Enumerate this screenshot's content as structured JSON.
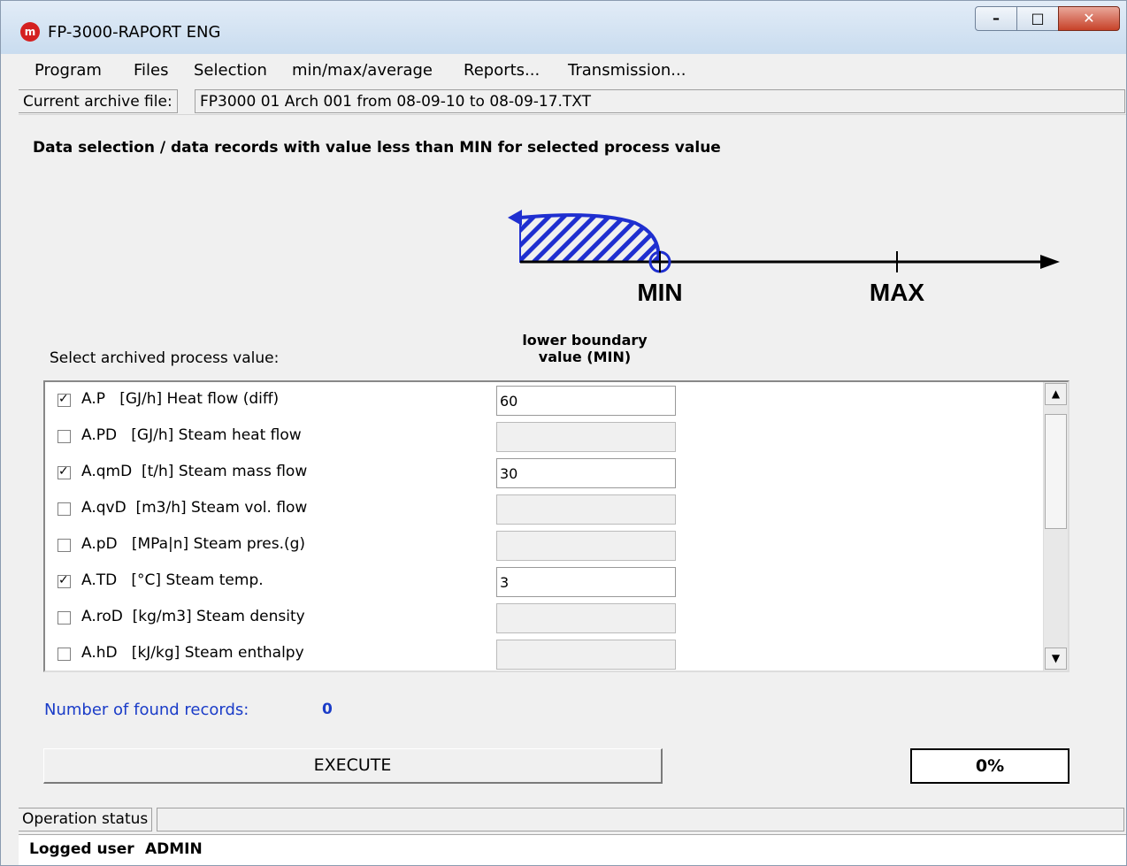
{
  "window": {
    "title": "FP-3000-RAPORT ENG",
    "icon_text": "m",
    "controls": [
      "minimize",
      "maximize",
      "close"
    ]
  },
  "menu": [
    "Program",
    "Files",
    "Selection",
    "min/max/average",
    "Reports...",
    "Transmission..."
  ],
  "archive": {
    "label": "Current archive file:",
    "value": "FP3000 01 Arch 001 from 08-09-10 to 08-09-17.TXT"
  },
  "heading": "Data selection / data records with value less than MIN for selected process value",
  "diagram": {
    "min_label": "MIN",
    "max_label": "MAX"
  },
  "select_label": "Select archived process value:",
  "column_header": [
    "lower boundary",
    "value (MIN)"
  ],
  "rows": [
    {
      "checked": true,
      "label": "A.P   [GJ/h] Heat flow (diff)",
      "value": "60"
    },
    {
      "checked": false,
      "label": "A.PD   [GJ/h] Steam heat flow",
      "value": ""
    },
    {
      "checked": true,
      "label": "A.qmD  [t/h] Steam mass flow",
      "value": "30"
    },
    {
      "checked": false,
      "label": "A.qvD  [m3/h] Steam vol. flow",
      "value": ""
    },
    {
      "checked": false,
      "label": "A.pD   [MPa|n] Steam pres.(g)",
      "value": ""
    },
    {
      "checked": true,
      "label": "A.TD   [°C] Steam temp.",
      "value": "3"
    },
    {
      "checked": false,
      "label": "A.roD  [kg/m3] Steam density",
      "value": ""
    },
    {
      "checked": false,
      "label": "A.hD   [kJ/kg] Steam enthalpy",
      "value": ""
    }
  ],
  "found": {
    "label": "Number of found records:",
    "value": "0"
  },
  "execute_label": "EXECUTE",
  "progress": "0%",
  "status": {
    "label": "Operation status",
    "value": ""
  },
  "user": {
    "label": "Logged user",
    "value": "ADMIN"
  },
  "colors": {
    "accent_blue": "#1a3cc8",
    "hatch_blue": "#1f2fd0"
  }
}
